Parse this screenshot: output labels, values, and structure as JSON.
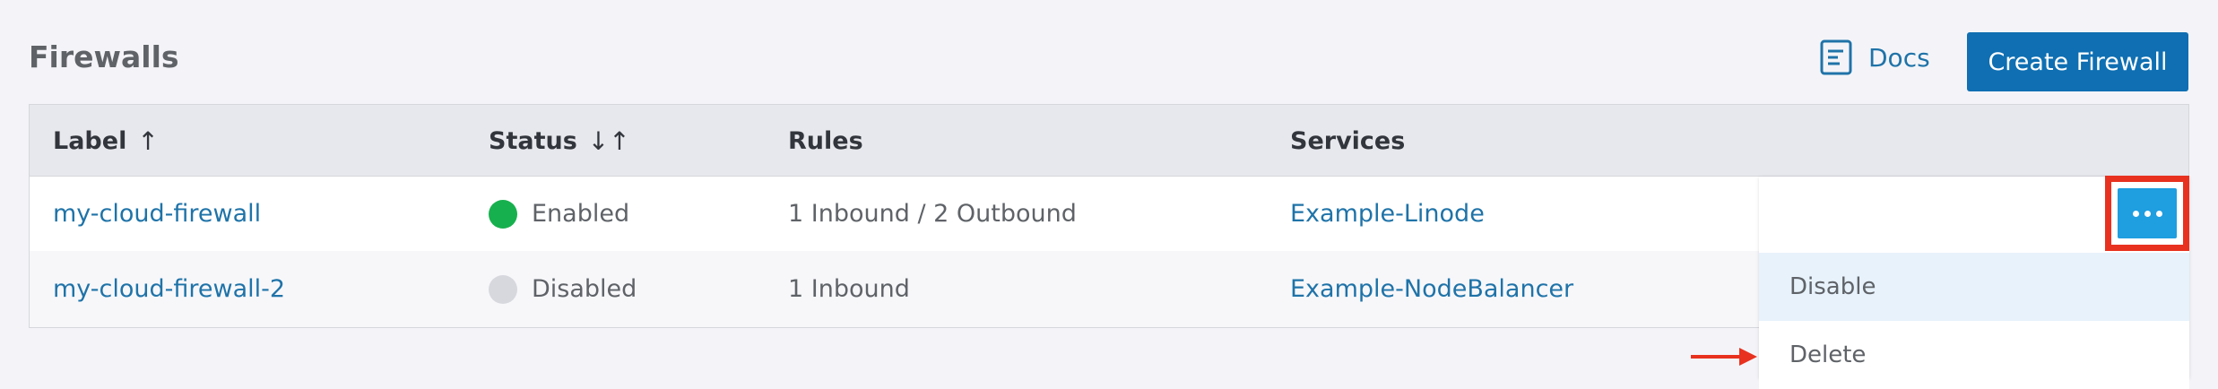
{
  "header": {
    "title": "Firewalls",
    "docs_label": "Docs",
    "create_label": "Create Firewall"
  },
  "table": {
    "columns": [
      {
        "label": "Label",
        "sort_icon": "↑"
      },
      {
        "label": "Status",
        "sort_icon": "↓↑"
      },
      {
        "label": "Rules"
      },
      {
        "label": "Services"
      }
    ],
    "rows": [
      {
        "label": "my-cloud-firewall",
        "status": "Enabled",
        "status_color": "#17b04e",
        "rules": "1 Inbound / 2 Outbound",
        "services": "Example-Linode"
      },
      {
        "label": "my-cloud-firewall-2",
        "status": "Disabled",
        "status_color": "#d7d8de",
        "rules": "1 Inbound",
        "services": "Example-NodeBalancer"
      }
    ]
  },
  "action_menu": {
    "items": [
      "Disable",
      "Delete"
    ]
  },
  "colors": {
    "accent": "#0f6fb2",
    "link": "#1f73a8",
    "highlight": "#e8311f"
  }
}
